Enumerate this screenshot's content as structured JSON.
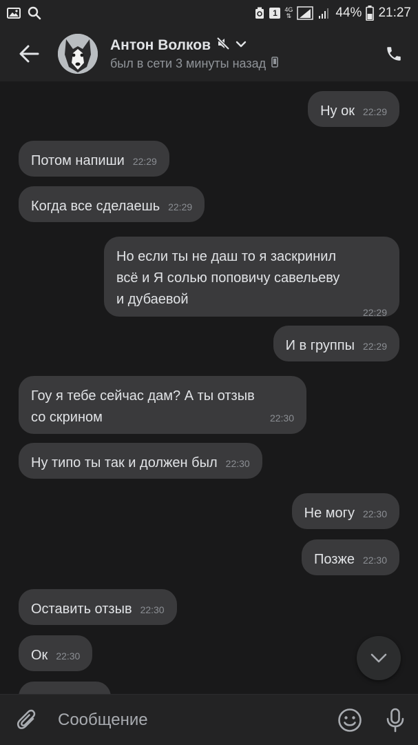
{
  "status_bar": {
    "network": "4G",
    "sim_badge": "1",
    "battery": "44%",
    "time": "21:27"
  },
  "header": {
    "name": "Антон Волков",
    "status": "был в сети 3 минуты назад",
    "icons": [
      "back-arrow-icon",
      "muted-icon",
      "chevron-down-icon",
      "mobile-icon",
      "phone-icon"
    ]
  },
  "messages": [
    {
      "dir": "out",
      "text": "Ну ок",
      "time": "22:29"
    },
    {
      "dir": "in",
      "text": "Потом напиши",
      "time": "22:29"
    },
    {
      "dir": "in",
      "text": "Когда все сделаешь",
      "time": "22:29"
    },
    {
      "dir": "out",
      "lines": [
        "Но если ты не даш то я заскринил",
        "всё  и Я солью поповичу савельеву",
        "и   дубаевой"
      ],
      "time": "22:29"
    },
    {
      "dir": "out",
      "text": "И в группы",
      "time": "22:29"
    },
    {
      "dir": "in",
      "lines": [
        "Гоу я тебе сейчас дам? А ты отзыв",
        "со скрином"
      ],
      "time": "22:30"
    },
    {
      "dir": "in",
      "text": "Ну типо ты так и должен был",
      "time": "22:30"
    },
    {
      "dir": "out",
      "text": "Не могу",
      "time": "22:30"
    },
    {
      "dir": "out",
      "text": "Позже",
      "time": "22:30"
    },
    {
      "dir": "in",
      "text": "Оставить отзыв",
      "time": "22:30"
    },
    {
      "dir": "in",
      "text": "Ок",
      "time": "22:30"
    }
  ],
  "composer": {
    "placeholder": "Сообщение",
    "icons": [
      "attach-icon",
      "emoji-icon",
      "microphone-icon"
    ]
  }
}
